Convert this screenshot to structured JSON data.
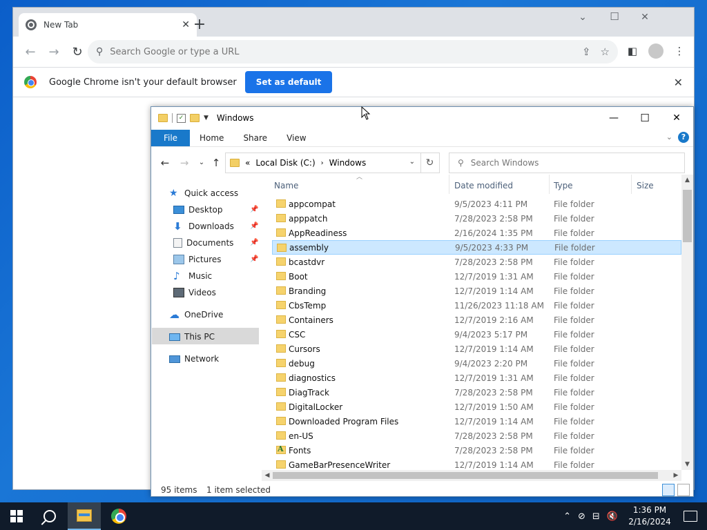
{
  "chrome": {
    "tab_title": "New Tab",
    "omnibox_placeholder": "Search Google or type a URL",
    "infobar_message": "Google Chrome isn't your default browser",
    "set_default_label": "Set as default"
  },
  "explorer": {
    "window_title": "Windows",
    "ribbon_tabs": [
      "File",
      "Home",
      "Share",
      "View"
    ],
    "breadcrumb": {
      "prefix": "«",
      "items": [
        "Local Disk (C:)",
        "Windows"
      ]
    },
    "search_placeholder": "Search Windows",
    "nav": {
      "quick_access": "Quick access",
      "desktop": "Desktop",
      "downloads": "Downloads",
      "documents": "Documents",
      "pictures": "Pictures",
      "music": "Music",
      "videos": "Videos",
      "onedrive": "OneDrive",
      "this_pc": "This PC",
      "network": "Network"
    },
    "columns": [
      "Name",
      "Date modified",
      "Type",
      "Size"
    ],
    "files": [
      {
        "name": "appcompat",
        "date": "9/5/2023 4:11 PM",
        "type": "File folder"
      },
      {
        "name": "apppatch",
        "date": "7/28/2023 2:58 PM",
        "type": "File folder"
      },
      {
        "name": "AppReadiness",
        "date": "2/16/2024 1:35 PM",
        "type": "File folder"
      },
      {
        "name": "assembly",
        "date": "9/5/2023 4:33 PM",
        "type": "File folder"
      },
      {
        "name": "bcastdvr",
        "date": "7/28/2023 2:58 PM",
        "type": "File folder"
      },
      {
        "name": "Boot",
        "date": "12/7/2019 1:31 AM",
        "type": "File folder"
      },
      {
        "name": "Branding",
        "date": "12/7/2019 1:14 AM",
        "type": "File folder"
      },
      {
        "name": "CbsTemp",
        "date": "11/26/2023 11:18 AM",
        "type": "File folder"
      },
      {
        "name": "Containers",
        "date": "12/7/2019 2:16 AM",
        "type": "File folder"
      },
      {
        "name": "CSC",
        "date": "9/4/2023 5:17 PM",
        "type": "File folder"
      },
      {
        "name": "Cursors",
        "date": "12/7/2019 1:14 AM",
        "type": "File folder"
      },
      {
        "name": "debug",
        "date": "9/4/2023 2:20 PM",
        "type": "File folder"
      },
      {
        "name": "diagnostics",
        "date": "12/7/2019 1:31 AM",
        "type": "File folder"
      },
      {
        "name": "DiagTrack",
        "date": "7/28/2023 2:58 PM",
        "type": "File folder"
      },
      {
        "name": "DigitalLocker",
        "date": "12/7/2019 1:50 AM",
        "type": "File folder"
      },
      {
        "name": "Downloaded Program Files",
        "date": "12/7/2019 1:14 AM",
        "type": "File folder"
      },
      {
        "name": "en-US",
        "date": "7/28/2023 2:58 PM",
        "type": "File folder"
      },
      {
        "name": "Fonts",
        "date": "7/28/2023 2:58 PM",
        "type": "File folder"
      },
      {
        "name": "GameBarPresenceWriter",
        "date": "12/7/2019 1:14 AM",
        "type": "File folder"
      }
    ],
    "selected_index": 3,
    "status": {
      "items": "95 items",
      "selected": "1 item selected"
    }
  },
  "taskbar": {
    "time": "1:36 PM",
    "date": "2/16/2024"
  },
  "colors": {
    "accent": "#1a73e8",
    "file_tab": "#1979ca",
    "selection": "#cce8ff",
    "taskbar": "#101b2a"
  }
}
